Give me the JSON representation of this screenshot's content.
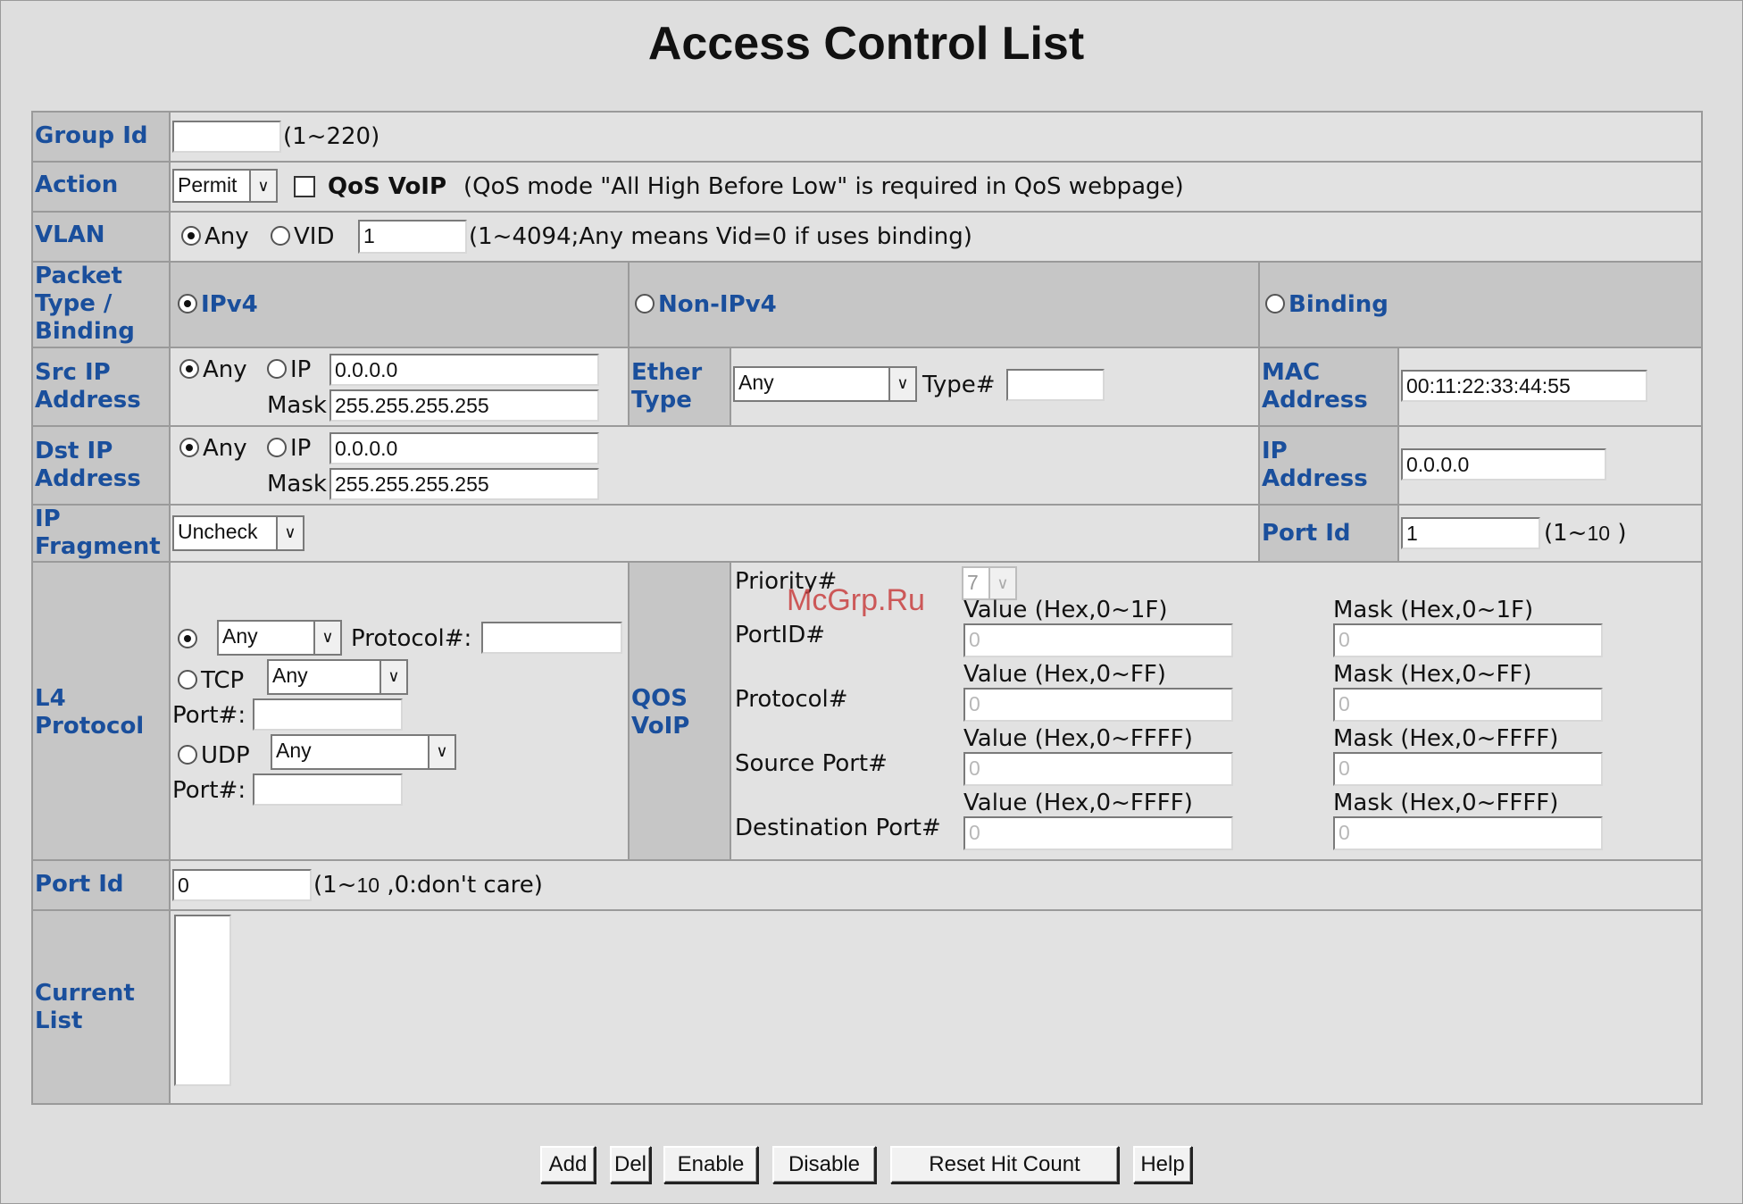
{
  "title": "Access Control List",
  "labels": {
    "group_id": "Group Id",
    "action": "Action",
    "vlan": "VLAN",
    "packet_type": [
      "Packet",
      "Type /",
      "Binding"
    ],
    "src_ip": [
      "Src IP",
      "Address"
    ],
    "dst_ip": [
      "Dst IP",
      "Address"
    ],
    "ip_fragment": [
      "IP",
      "Fragment"
    ],
    "l4_protocol": [
      "L4",
      "Protocol"
    ],
    "port_id": "Port Id",
    "current_list": [
      "Current",
      "List"
    ],
    "ether_type": [
      "Ether",
      "Type"
    ],
    "mac_address": [
      "MAC",
      "Address"
    ],
    "ip_address": [
      "IP",
      "Address"
    ],
    "binding_port_id": "Port Id",
    "qos_voip": [
      "QOS",
      "VoIP"
    ]
  },
  "group_id": {
    "value": "",
    "hint": "(1~220)"
  },
  "action": {
    "selected": "Permit",
    "qos_voip_label": "QoS VoIP",
    "qos_voip_note": "(QoS mode \"All High Before Low\" is required in QoS webpage)"
  },
  "vlan": {
    "any": "Any",
    "vid": "VID",
    "value": "1",
    "hint": "(1~4094;Any means Vid=0 if uses binding)"
  },
  "packet_type": {
    "ipv4": "IPv4",
    "non_ipv4": "Non-IPv4",
    "binding": "Binding"
  },
  "src_ip": {
    "any": "Any",
    "ip": "IP",
    "ip_value": "0.0.0.0",
    "mask_label": "Mask",
    "mask_value": "255.255.255.255"
  },
  "dst_ip": {
    "any": "Any",
    "ip": "IP",
    "ip_value": "0.0.0.0",
    "mask_label": "Mask",
    "mask_value": "255.255.255.255"
  },
  "ether_type": {
    "selected": "Any",
    "type_label": "Type#",
    "type_value": ""
  },
  "binding": {
    "mac_value": "00:11:22:33:44:55",
    "ip_value": "0.0.0.0",
    "port_value": "1",
    "port_hint_open": "(1~",
    "port_hint_num": "10",
    "port_hint_close": " )"
  },
  "ip_fragment": {
    "selected": "Uncheck"
  },
  "l4": {
    "any_selected": "Any",
    "protocol_label": "Protocol#:",
    "protocol_value": "",
    "tcp": "TCP",
    "tcp_selected": "Any",
    "tcp_port_label": "Port#:",
    "tcp_port_value": "",
    "udp": "UDP",
    "udp_selected": "Any",
    "udp_port_label": "Port#:",
    "udp_port_value": ""
  },
  "qos": {
    "priority_label": "Priority#",
    "priority_value": "7",
    "rows": [
      {
        "label": "PortID#",
        "value_label": "Value (Hex,0~1F)",
        "value": "0",
        "mask_label": "Mask (Hex,0~1F)",
        "mask": "0"
      },
      {
        "label": "Protocol#",
        "value_label": "Value (Hex,0~FF)",
        "value": "0",
        "mask_label": "Mask (Hex,0~FF)",
        "mask": "0"
      },
      {
        "label": "Source Port#",
        "value_label": "Value (Hex,0~FFFF)",
        "value": "0",
        "mask_label": "Mask (Hex,0~FFFF)",
        "mask": "0"
      },
      {
        "label": "Destination Port#",
        "value_label": "Value (Hex,0~FFFF)",
        "value": "0",
        "mask_label": "Mask (Hex,0~FFFF)",
        "mask": "0"
      }
    ]
  },
  "port_id": {
    "value": "0",
    "hint_open": "(1~",
    "hint_num": "10",
    "hint_close": " ,0:don't care)"
  },
  "buttons": {
    "add": "Add",
    "del": "Del",
    "enable": "Enable",
    "disable": "Disable",
    "reset": "Reset Hit Count",
    "help": "Help"
  },
  "watermark": "McGrp.Ru"
}
